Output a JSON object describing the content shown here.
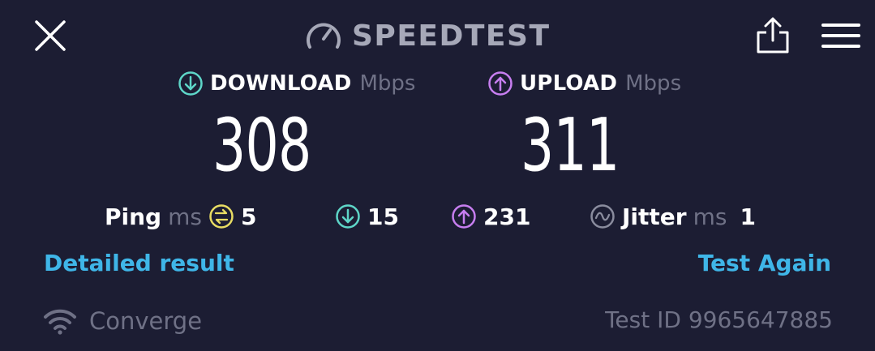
{
  "header": {
    "title": "SPEEDTEST",
    "icons": {
      "close": "close-icon",
      "brand": "speedometer-icon",
      "share": "share-icon",
      "menu": "menu-icon"
    }
  },
  "download": {
    "label": "DOWNLOAD",
    "unit": "Mbps",
    "value": "308",
    "color": "#5ed6c8"
  },
  "upload": {
    "label": "UPLOAD",
    "unit": "Mbps",
    "value": "311",
    "color": "#c77ef0"
  },
  "stats": {
    "ping_label": "Ping",
    "ping_unit": "ms",
    "ping_idle": "5",
    "ping_download": "15",
    "ping_upload": "231",
    "jitter_label": "Jitter",
    "jitter_unit": "ms",
    "jitter_value": "1"
  },
  "links": {
    "detailed": "Detailed result",
    "again": "Test Again"
  },
  "footer": {
    "provider": "Converge",
    "test_id_label": "Test ID",
    "test_id": "9965647885"
  },
  "colors": {
    "background": "#1c1d33",
    "accent_link": "#3fb6e8",
    "ping_idle": "#e8dc63",
    "muted": "#6f7186"
  }
}
